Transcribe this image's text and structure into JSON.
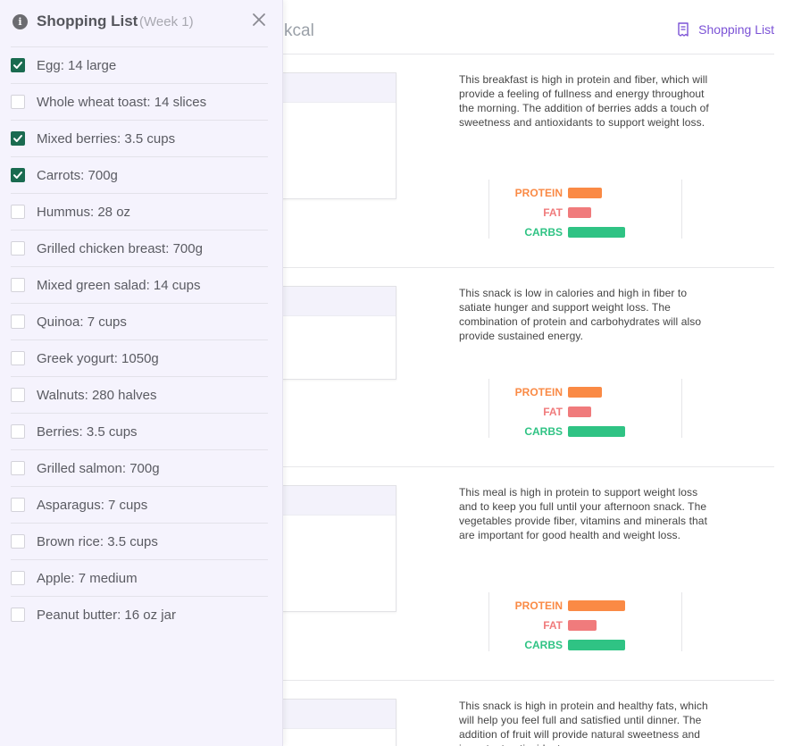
{
  "header": {
    "kcal_text": "kcal",
    "shopping_link_label": "Shopping List"
  },
  "meals": [
    {
      "description": "This breakfast is high in protein and fiber, which will provide a feeling of fullness and energy throughout the morning. The addition of berries adds a touch of sweetness and antioxidants to support weight loss.",
      "macros": {
        "protein_label": "PROTEIN",
        "fat_label": "FAT",
        "carbs_label": "CARBS",
        "protein": 0.6,
        "fat": 0.4,
        "carbs": 1.0
      }
    },
    {
      "description": "This snack is low in calories and high in fiber to satiate hunger and support weight loss. The combination of protein and carbohydrates will also provide sustained energy.",
      "macros": {
        "protein_label": "PROTEIN",
        "fat_label": "FAT",
        "carbs_label": "CARBS",
        "protein": 0.6,
        "fat": 0.4,
        "carbs": 1.0
      }
    },
    {
      "description": "This meal is high in protein to support weight loss and to keep you full until your afternoon snack. The vegetables provide fiber, vitamins and minerals that are important for good health and weight loss.",
      "macros": {
        "protein_label": "PROTEIN",
        "fat_label": "FAT",
        "carbs_label": "CARBS",
        "protein": 1.0,
        "fat": 0.5,
        "carbs": 1.0
      }
    },
    {
      "description": "This snack is high in protein and healthy fats, which will help you feel full and satisfied until dinner. The addition of fruit will provide natural sweetness and important antioxidants."
    }
  ],
  "sidebar": {
    "title": "Shopping List",
    "week": "(Week 1)",
    "items": [
      {
        "label": "Egg: 14 large",
        "checked": true
      },
      {
        "label": "Whole wheat toast: 14 slices",
        "checked": false
      },
      {
        "label": "Mixed berries: 3.5 cups",
        "checked": true
      },
      {
        "label": "Carrots: 700g",
        "checked": true
      },
      {
        "label": "Hummus: 28 oz",
        "checked": false
      },
      {
        "label": "Grilled chicken breast: 700g",
        "checked": false
      },
      {
        "label": "Mixed green salad: 14 cups",
        "checked": false
      },
      {
        "label": "Quinoa: 7 cups",
        "checked": false
      },
      {
        "label": "Greek yogurt: 1050g",
        "checked": false
      },
      {
        "label": "Walnuts: 280 halves",
        "checked": false
      },
      {
        "label": "Berries: 3.5 cups",
        "checked": false
      },
      {
        "label": "Grilled salmon: 700g",
        "checked": false
      },
      {
        "label": "Asparagus: 7 cups",
        "checked": false
      },
      {
        "label": "Brown rice: 3.5 cups",
        "checked": false
      },
      {
        "label": "Apple: 7 medium",
        "checked": false
      },
      {
        "label": "Peanut butter: 16 oz jar",
        "checked": false
      }
    ]
  },
  "colors": {
    "accent": "#7b52d6",
    "checked": "#1a6b50",
    "protein": "#fa8a45",
    "fat": "#f07b7c",
    "carbs": "#2fc384"
  }
}
